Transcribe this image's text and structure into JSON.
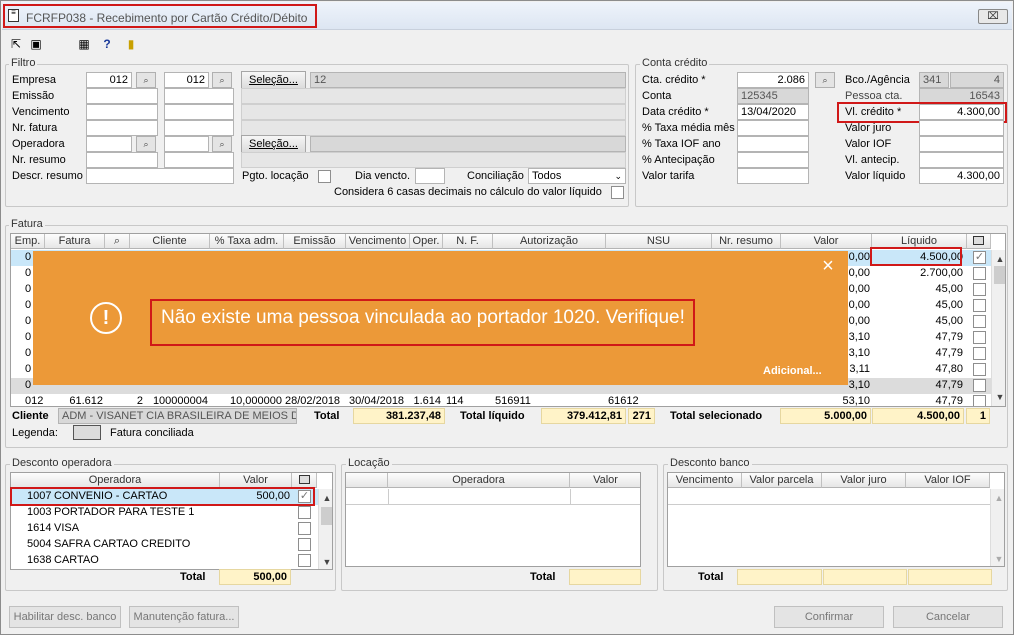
{
  "window": {
    "title": "FCRFP038 - Recebimento por Cartão Crédito/Débito",
    "close_glyph": "⌧"
  },
  "filtro": {
    "title": "Filtro",
    "empresa_label": "Empresa",
    "empresa_from": "012",
    "empresa_to": "012",
    "emissao_label": "Emissão",
    "vencimento_label": "Vencimento",
    "nr_fatura_label": "Nr. fatura",
    "operadora_label": "Operadora",
    "nr_resumo_label": "Nr. resumo",
    "descr_resumo_label": "Descr. resumo",
    "selecao1_label": "Seleção...",
    "selecao1_value": "12",
    "selecao2_label": "Seleção...",
    "pgto_locacao_label": "Pgto. locação",
    "dia_vencto_label": "Dia vencto.",
    "conciliacao_label": "Conciliação",
    "conciliacao_value": "Todos",
    "considera_label": "Considera 6 casas decimais no cálculo do valor líquido",
    "lookup_glyph": "⌕"
  },
  "conta_credito": {
    "title": "Conta crédito",
    "cta_credito_label": "Cta. crédito *",
    "cta_credito_value": "2.086",
    "conta_label": "Conta",
    "conta_value": "125345",
    "data_credito_label": "Data crédito *",
    "data_credito_value": "13/04/2020",
    "taxa_media_label": "% Taxa média mês",
    "taxa_iof_label": "% Taxa IOF ano",
    "antecipacao_label": "% Antecipação",
    "valor_tarifa_label": "Valor tarifa",
    "bco_agencia_label": "Bco./Agência",
    "bco_value": "341",
    "agencia_value": "4",
    "pessoa_cta_label": "Pessoa cta.",
    "pessoa_cta_value": "16543",
    "vl_credito_label": "Vl. crédito *",
    "vl_credito_value": "4.300,00",
    "valor_juro_label": "Valor juro",
    "valor_iof_label": "Valor IOF",
    "vl_antecip_label": "Vl. antecip.",
    "valor_liquido_label": "Valor líquido",
    "valor_liquido_value": "4.300,00"
  },
  "fatura": {
    "title": "Fatura",
    "columns": [
      "Emp.",
      "Fatura",
      "",
      "Cliente",
      "% Taxa adm.",
      "Emissão",
      "Vencimento",
      "Oper.",
      "N. F.",
      "Autorização",
      "NSU",
      "Nr. resumo",
      "Valor",
      "Líquido"
    ],
    "rows": [
      {
        "emp": "0",
        "valor": "0,00",
        "liquido": "4.500,00"
      },
      {
        "emp": "0",
        "valor": "0,00",
        "liquido": "2.700,00"
      },
      {
        "emp": "0",
        "valor": "0,00",
        "liquido": "45,00"
      },
      {
        "emp": "0",
        "valor": "0,00",
        "liquido": "45,00"
      },
      {
        "emp": "0",
        "valor": "0,00",
        "liquido": "45,00"
      },
      {
        "emp": "0",
        "valor": "3,10",
        "liquido": "47,79"
      },
      {
        "emp": "0",
        "valor": "3,10",
        "liquido": "47,79"
      },
      {
        "emp": "0",
        "valor": "3,11",
        "liquido": "47,80"
      },
      {
        "emp": "0",
        "valor": "3,10",
        "liquido": "47,79"
      }
    ],
    "last_row": {
      "emp": "012",
      "fatura": "61.612",
      "seq": "2",
      "cliente": "100000004",
      "taxa": "10,000000",
      "emissao": "28/02/2018",
      "vencimento": "30/04/2018",
      "oper": "1.614",
      "nf": "114",
      "autorizacao": "516911",
      "nsu": "61612",
      "valor": "53,10",
      "liquido": "47,79"
    },
    "cliente_label": "Cliente",
    "cliente_value": "ADM - VISANET CIA BRASILEIRA DE MEIOS DE PA",
    "total_label": "Total",
    "total_value": "381.237,48",
    "total_liquido_label": "Total líquido",
    "total_liquido_value": "379.412,81",
    "total_count": "271",
    "total_selecionado_label": "Total selecionado",
    "total_sel_valor": "5.000,00",
    "total_sel_liquido": "4.500,00",
    "total_sel_count": "1",
    "legenda_label": "Legenda:",
    "legenda_item": "Fatura conciliada"
  },
  "desconto_operadora": {
    "title": "Desconto operadora",
    "columns": [
      "Operadora",
      "Valor"
    ],
    "rows": [
      {
        "codigo": "1007",
        "nome": "CONVENIO - CARTAO",
        "valor": "500,00"
      },
      {
        "codigo": "1003",
        "nome": "PORTADOR PARA TESTE 1",
        "valor": ""
      },
      {
        "codigo": "1614",
        "nome": "VISA",
        "valor": ""
      },
      {
        "codigo": "5004",
        "nome": "SAFRA CARTAO CREDITO",
        "valor": ""
      },
      {
        "codigo": "1638",
        "nome": "CARTAO",
        "valor": ""
      }
    ],
    "total_label": "Total",
    "total_value": "500,00"
  },
  "locacao": {
    "title": "Locação",
    "columns": [
      "Operadora",
      "Valor"
    ],
    "total_label": "Total"
  },
  "desconto_banco": {
    "title": "Desconto banco",
    "columns": [
      "Vencimento",
      "Valor parcela",
      "Valor juro",
      "Valor IOF"
    ],
    "total_label": "Total"
  },
  "buttons": {
    "habilitar": "Habilitar desc. banco",
    "manutencao": "Manutenção fatura...",
    "confirmar": "Confirmar",
    "cancelar": "Cancelar"
  },
  "toast": {
    "message": "Não existe uma pessoa vinculada ao portador 1020. Verifique!",
    "adicional": "Adicional...",
    "close": "×",
    "icon": "!"
  },
  "icons": {
    "check": "✓",
    "up": "▲",
    "down": "▼"
  }
}
